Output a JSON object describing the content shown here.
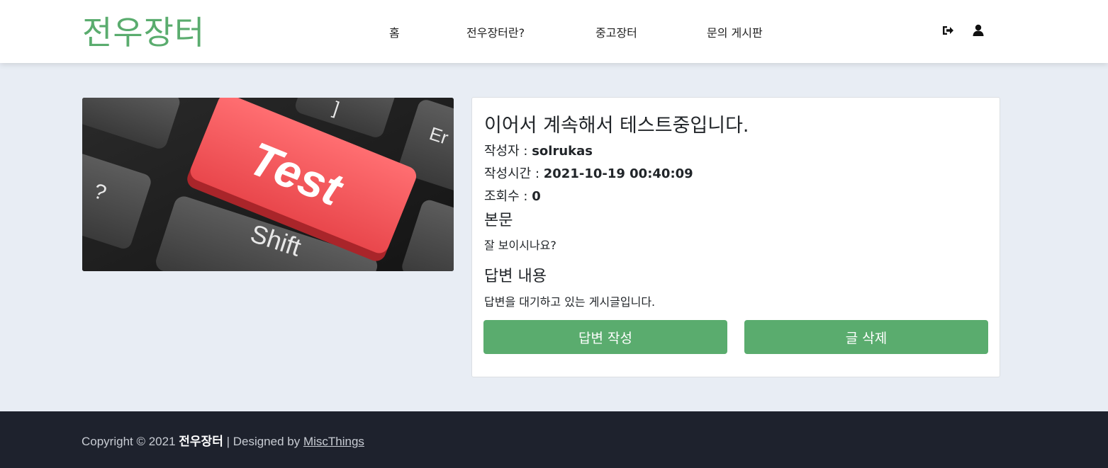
{
  "header": {
    "logo": "전우장터",
    "nav": [
      "홈",
      "전우장터란?",
      "중고장터",
      "문의 게시판"
    ],
    "icons": [
      "logout-icon",
      "user-icon"
    ]
  },
  "post": {
    "image_text": {
      "key": "Test",
      "shift": "Shift",
      "question": "?",
      "bracket": "]",
      "enter": "Er"
    },
    "title": "이어서 계속해서 테스트중입니다.",
    "author_label": "작성자 : ",
    "author": "solrukas",
    "time_label": "작성시간 : ",
    "time": "2021-10-19 00:40:09",
    "views_label": "조회수 : ",
    "views": "0",
    "body_heading": "본문",
    "body": "잘 보이시나요?",
    "answer_heading": "답변 내용",
    "answer": "답변을 대기하고 있는 게시글입니다.",
    "buttons": {
      "answer": "답변 작성",
      "delete": "글 삭제"
    }
  },
  "footer": {
    "prefix": "Copyright © 2021 ",
    "brand": "전우장터",
    "middle": " | Designed by ",
    "designer": "MiscThings"
  },
  "colors": {
    "accent": "#5aac6e",
    "background": "#e8edf4",
    "footer": "#1e222d",
    "key_red": "#f05a5e"
  }
}
